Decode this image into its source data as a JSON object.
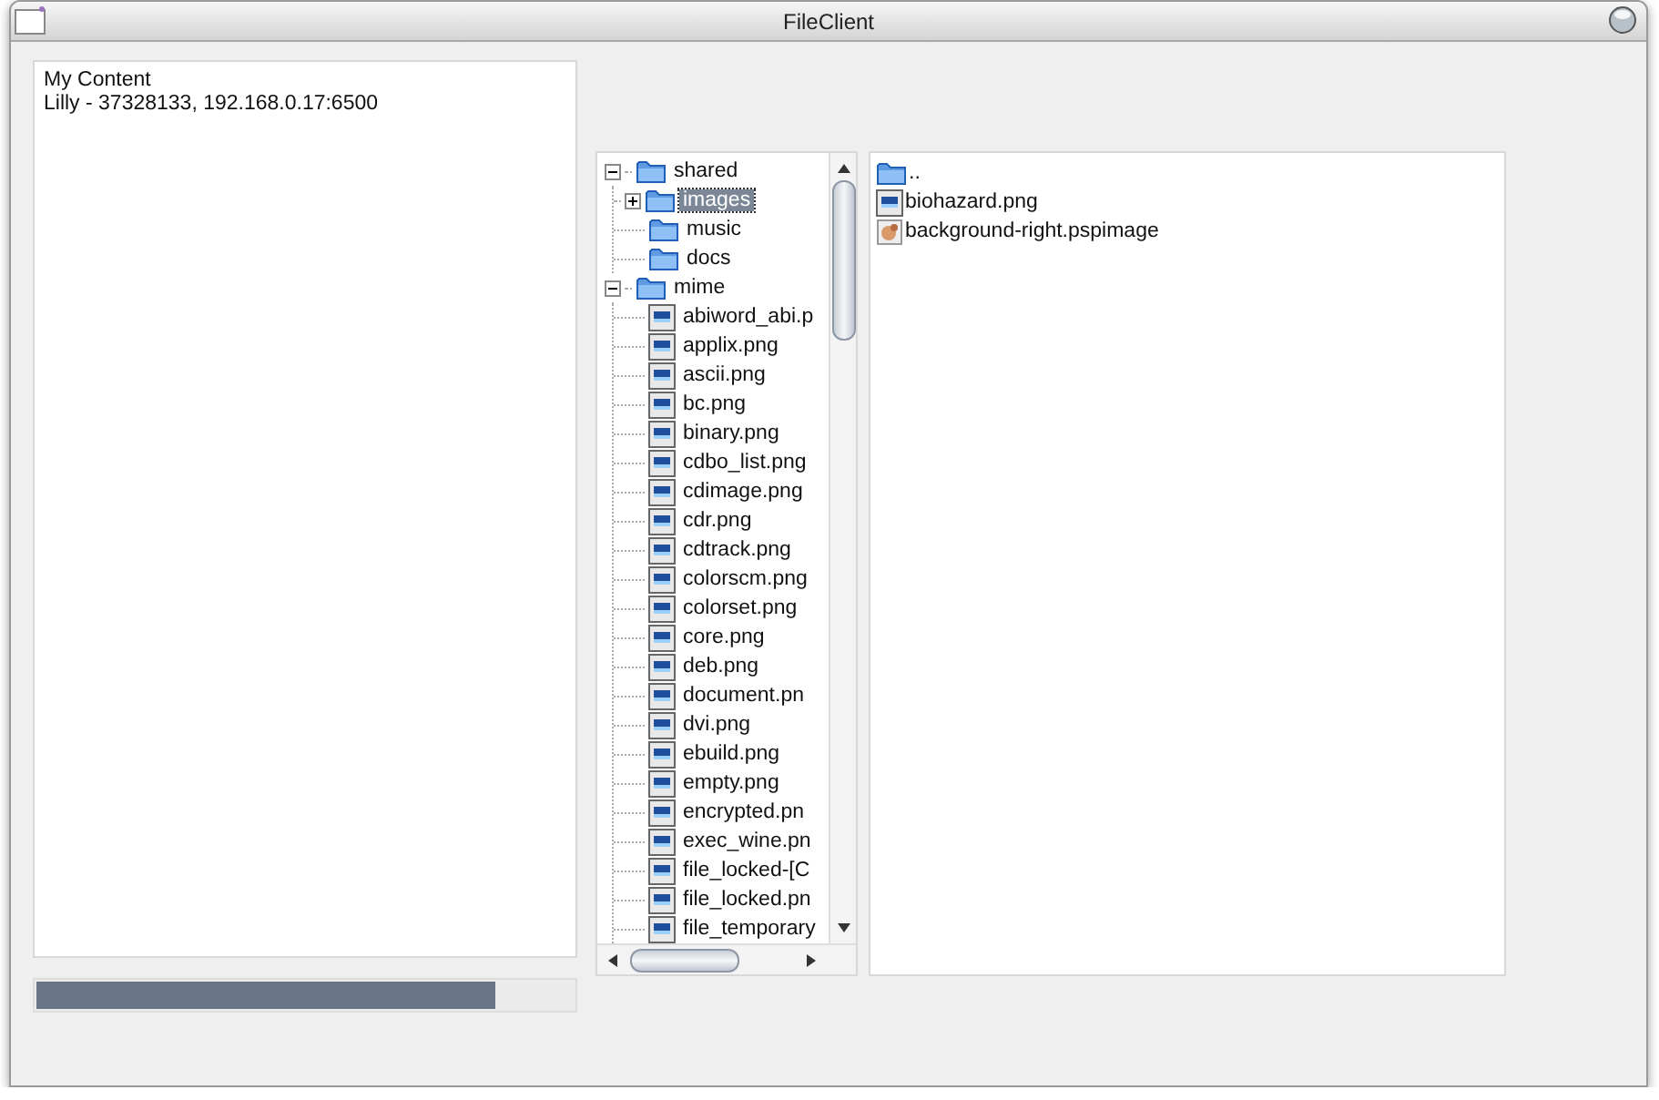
{
  "window": {
    "title": "FileClient"
  },
  "content_panel": {
    "lines": [
      "My Content",
      "Lilly - 37328133, 192.168.0.17:6500"
    ]
  },
  "progress": {
    "level": 0.855
  },
  "tree": [
    {
      "label": "shared",
      "kind": "folder",
      "expanded": true,
      "selected": false,
      "children": [
        {
          "label": "images",
          "kind": "folder",
          "expanded": false,
          "selected": true
        },
        {
          "label": "music",
          "kind": "folder",
          "selected": false
        },
        {
          "label": "docs",
          "kind": "folder",
          "selected": false
        }
      ]
    },
    {
      "label": "mime",
      "kind": "folder",
      "expanded": true,
      "selected": false,
      "children": [
        {
          "label": "abiword_abi.p",
          "kind": "image",
          "selected": false
        },
        {
          "label": "applix.png",
          "kind": "image",
          "selected": false
        },
        {
          "label": "ascii.png",
          "kind": "image",
          "selected": false
        },
        {
          "label": "bc.png",
          "kind": "image",
          "selected": false
        },
        {
          "label": "binary.png",
          "kind": "image",
          "selected": false
        },
        {
          "label": "cdbo_list.png",
          "kind": "image",
          "selected": false
        },
        {
          "label": "cdimage.png",
          "kind": "image",
          "selected": false
        },
        {
          "label": "cdr.png",
          "kind": "image",
          "selected": false
        },
        {
          "label": "cdtrack.png",
          "kind": "image",
          "selected": false
        },
        {
          "label": "colorscm.png",
          "kind": "image",
          "selected": false
        },
        {
          "label": "colorset.png",
          "kind": "image",
          "selected": false
        },
        {
          "label": "core.png",
          "kind": "image",
          "selected": false
        },
        {
          "label": "deb.png",
          "kind": "image",
          "selected": false
        },
        {
          "label": "document.pn",
          "kind": "image",
          "selected": false
        },
        {
          "label": "dvi.png",
          "kind": "image",
          "selected": false
        },
        {
          "label": "ebuild.png",
          "kind": "image",
          "selected": false
        },
        {
          "label": "empty.png",
          "kind": "image",
          "selected": false
        },
        {
          "label": "encrypted.pn",
          "kind": "image",
          "selected": false
        },
        {
          "label": "exec_wine.pn",
          "kind": "image",
          "selected": false
        },
        {
          "label": "file_locked-[C",
          "kind": "image",
          "selected": false
        },
        {
          "label": "file_locked.pn",
          "kind": "image",
          "selected": false
        },
        {
          "label": "file_temporary",
          "kind": "image",
          "selected": false
        }
      ]
    }
  ],
  "files": [
    {
      "label": "..",
      "kind": "folder"
    },
    {
      "label": "biohazard.png",
      "kind": "image"
    },
    {
      "label": "background-right.pspimage",
      "kind": "photo"
    }
  ]
}
